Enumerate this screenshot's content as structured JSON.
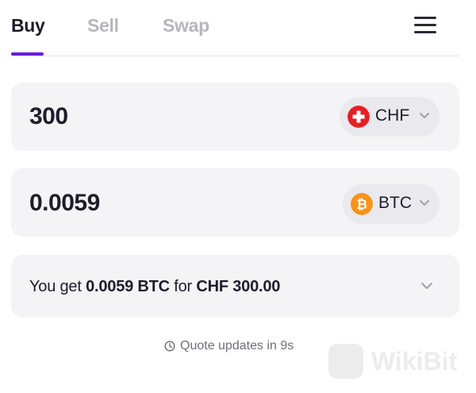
{
  "tabs": {
    "buy": "Buy",
    "sell": "Sell",
    "swap": "Swap"
  },
  "pay": {
    "amount": "300",
    "currency": "CHF",
    "currency_icon": "swiss-flag-icon",
    "icon_color": "#e51f23"
  },
  "receive": {
    "amount": "0.0059",
    "currency": "BTC",
    "currency_icon": "bitcoin-icon",
    "icon_color": "#f7931a"
  },
  "quote": {
    "prefix": "You get",
    "crypto_amount": "0.0059 BTC",
    "connector": "for",
    "fiat_amount": "CHF 300.00"
  },
  "footer": {
    "text": "Quote updates in 9s"
  },
  "watermark": {
    "text": "WikiBit"
  },
  "colors": {
    "accent": "#6a1be0",
    "card_bg": "#f4f4f6",
    "pill_bg": "#e9e9ee"
  }
}
